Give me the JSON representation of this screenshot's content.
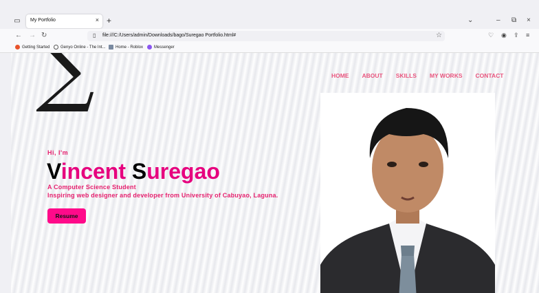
{
  "browser": {
    "tab": {
      "title": "My Portfolio",
      "close": "×"
    },
    "new_tab": "+",
    "controls": {
      "list": "⌄",
      "minimize": "–",
      "restore": "⧉",
      "close": "×"
    },
    "nav": {
      "back": "←",
      "forward": "→",
      "reload": "↻"
    },
    "url": "file:///C:/Users/admin/Downloads/bago/Suregao Portfolio.html#",
    "bookmarks": [
      {
        "label": "Getting Started",
        "color": "#e8532b"
      },
      {
        "label": "Genyo Online - The Int...",
        "color": "#555555"
      },
      {
        "label": "Home - Roblox",
        "color": "#7a8aa0"
      },
      {
        "label": "Messenger",
        "color": "#8a55f0"
      }
    ]
  },
  "site": {
    "logo": "∑",
    "menu": [
      "HOME",
      "ABOUT",
      "SKILLS",
      "MY WORKS",
      "CONTACT"
    ],
    "greeting": "Hi, I'm",
    "name": {
      "first_initial": "V",
      "first_rest": "incent ",
      "last_initial": "S",
      "last_rest": "uregao"
    },
    "subtitle1": "A Computer Science Student",
    "subtitle2": "Inspiring web designer and developer from University of Cabuyao, Laguna.",
    "resume_label": "Resume",
    "accent_color": "#e6007e"
  }
}
